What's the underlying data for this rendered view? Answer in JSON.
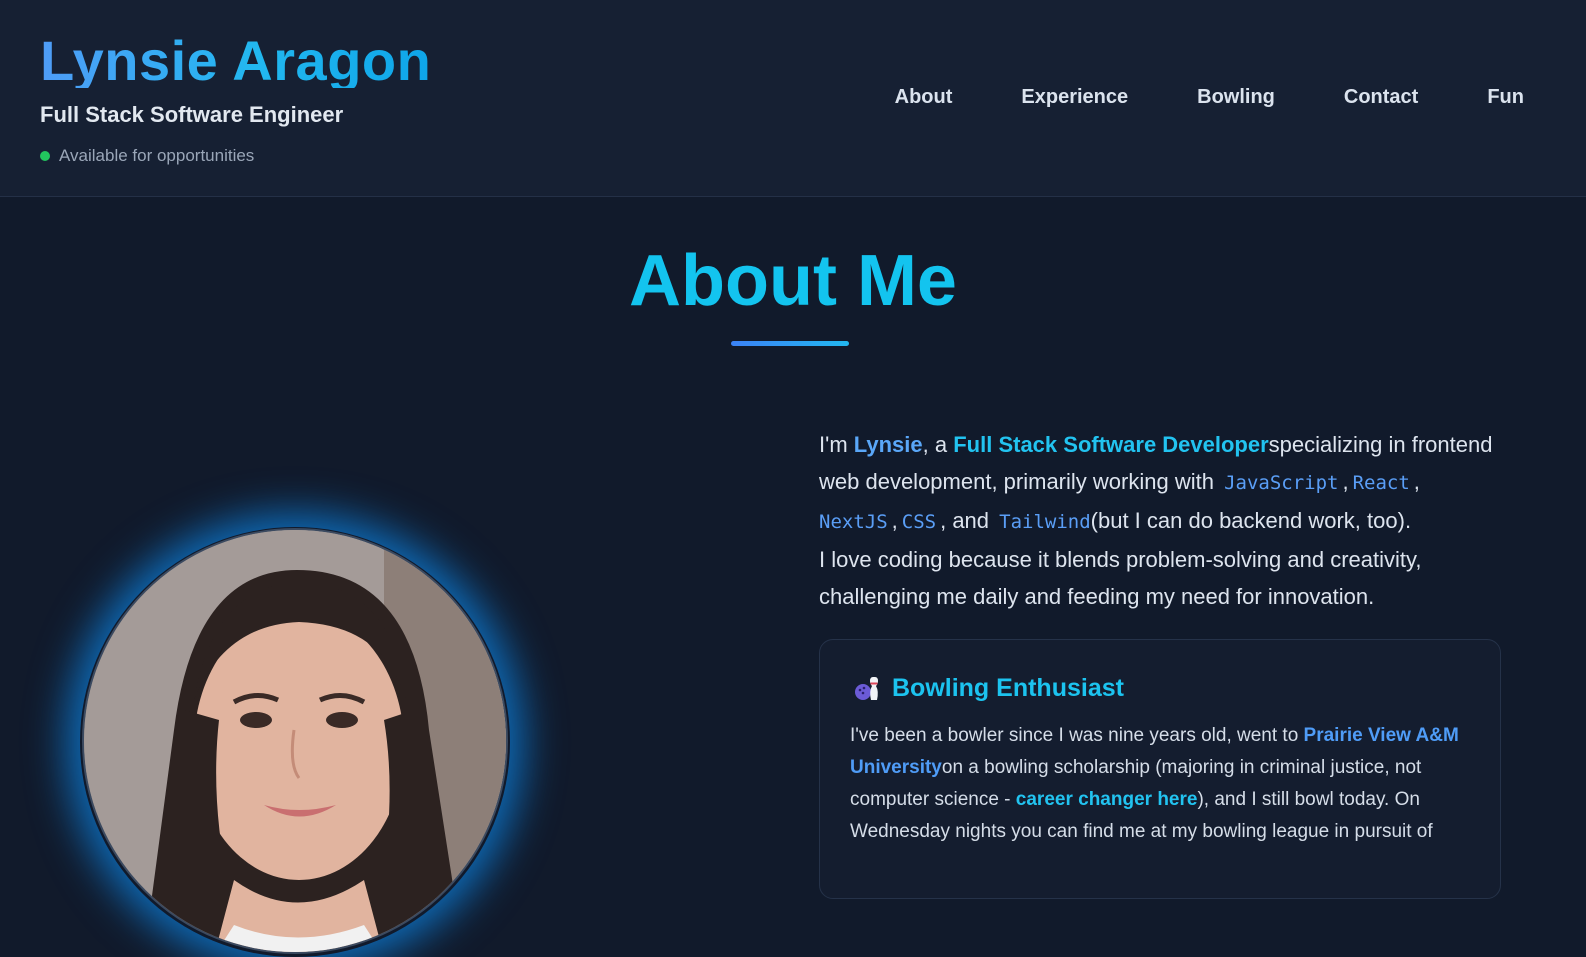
{
  "header": {
    "name": "Lynsie Aragon",
    "role": "Full Stack Software Engineer",
    "status": "Available for opportunities",
    "nav": [
      "About",
      "Experience",
      "Bowling",
      "Contact",
      "Fun"
    ]
  },
  "about": {
    "title": "About Me",
    "intro": {
      "im": "I'm ",
      "name": "Lynsie",
      "a": ", a ",
      "role": "Full Stack Software Developer",
      "rest1": "specializing in frontend web development, primarily working with ",
      "tech": [
        "JavaScript",
        "React",
        "NextJS",
        "CSS",
        "Tailwind"
      ],
      "comma": ",",
      "and": ", and ",
      "rest2": "(but I can do backend work, too).",
      "rest3": "I love coding because it blends problem-solving and creativity, challenging me daily and feeding my need for innovation."
    },
    "card": {
      "icon": "bowling-icon",
      "title": "Bowling Enthusiast",
      "body1": "I've been a bowler since I was nine years old, went to ",
      "school": "Prairie View A&M University",
      "body2": "on a bowling scholarship (majoring in criminal justice, not computer science - ",
      "career_link": "career changer here",
      "body3": "), and I still bowl today. On Wednesday nights you can find me at my bowling league in pursuit of"
    }
  },
  "colors": {
    "background": "#111a2b",
    "header": "#162033",
    "accent_cyan": "#13c4ef",
    "accent_blue": "#4f9cf7",
    "status_green": "#22c55e"
  }
}
